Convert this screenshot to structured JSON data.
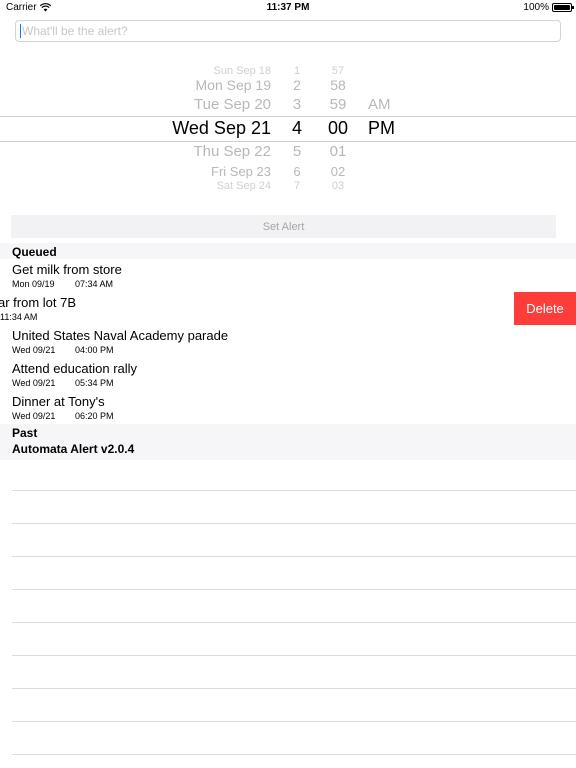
{
  "status_bar": {
    "carrier": "Carrier",
    "time": "11:37 PM",
    "battery": "100%",
    "wifi_icon": "wifi-icon",
    "battery_icon": "battery-icon"
  },
  "alert_input": {
    "placeholder": "What'll be the alert?",
    "value": ""
  },
  "picker": {
    "rows": [
      {
        "date": "Sun Sep 18",
        "hour": "1",
        "minute": "57",
        "ampm": ""
      },
      {
        "date": "Mon Sep 19",
        "hour": "2",
        "minute": "58",
        "ampm": ""
      },
      {
        "date": "Tue Sep 20",
        "hour": "3",
        "minute": "59",
        "ampm": "AM"
      },
      {
        "date": "Wed Sep 21",
        "hour": "4",
        "minute": "00",
        "ampm": "PM"
      },
      {
        "date": "Thu Sep 22",
        "hour": "5",
        "minute": "01",
        "ampm": ""
      },
      {
        "date": "Fri Sep 23",
        "hour": "6",
        "minute": "02",
        "ampm": ""
      },
      {
        "date": "Sat Sep 24",
        "hour": "7",
        "minute": "03",
        "ampm": ""
      }
    ]
  },
  "set_alert_label": "Set Alert",
  "queued": {
    "header": "Queued",
    "items": [
      {
        "title": "Get milk from store",
        "date": "Mon 09/19",
        "time": "07:34 AM"
      },
      {
        "title": "ar from lot 7B",
        "date": "",
        "time": "11:34 AM"
      },
      {
        "title": "United States Naval Academy parade",
        "date": "Wed 09/21",
        "time": "04:00 PM"
      },
      {
        "title": "Attend education rally",
        "date": "Wed 09/21",
        "time": "05:34 PM"
      },
      {
        "title": "Dinner at Tony's",
        "date": "Wed 09/21",
        "time": "06:20 PM"
      }
    ],
    "delete_label": "Delete"
  },
  "past": {
    "header": "Past"
  },
  "version": "Automata Alert v2.0.4"
}
